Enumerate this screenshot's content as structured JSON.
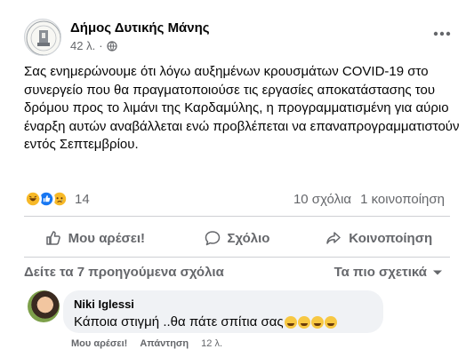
{
  "post": {
    "page_name": "Δήμος Δυτικής Μάνης",
    "time": "42 λ.",
    "privacy_icon": "globe-icon",
    "more_icon": "more-dots-icon",
    "text": "Σας ενημερώνουμε ότι λόγω αυξημένων κρουσμάτων COVID-19 στο συνεργείο που θα πραγματοποιούσε τις εργασίες αποκατάστασης του δρόμου προς το λιμάνι της Καρδαμύλης, η προγραμματισμένη για αύριο έναρξη αυτών αναβάλλεται ενώ προβλέπεται να επαναπρογραμματιστούν εντός Σεπτεμβρίου."
  },
  "summary": {
    "reaction_icons": [
      "haha-icon",
      "like-icon",
      "sad-icon"
    ],
    "reaction_count": "14",
    "comments": "10 σχόλια",
    "shares": "1 κοινοποίηση"
  },
  "actions": {
    "like": "Μου αρέσει!",
    "comment": "Σχόλιο",
    "share": "Κοινοποίηση"
  },
  "comments_section": {
    "prev_comments": "Δείτε τα 7 προηγούμενα σχόλια",
    "relevance": "Τα πιο σχετικά",
    "comment": {
      "author": "Niki Iglessi",
      "text": "Κάποια στιγμή ..θα πάτε σπίτια σας",
      "like": "Μου αρέσει!",
      "reply": "Απάντηση",
      "time": "12 λ."
    }
  },
  "colors": {
    "like_blue": "#1877f2",
    "haha_yellow": "#f7b928",
    "text_secondary": "#65676b",
    "bubble_bg": "#f0f2f5"
  }
}
